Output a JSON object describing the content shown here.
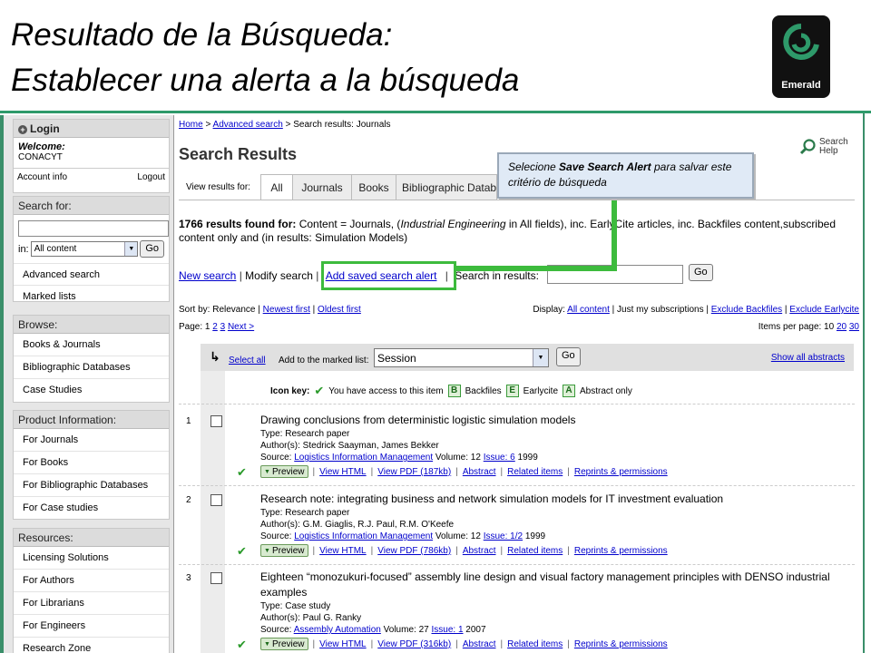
{
  "slide": {
    "title_line1": "Resultado de la Búsqueda:",
    "title_line2": "Establecer una alerta a la búsqueda",
    "logo_text": "Emerald"
  },
  "colors": {
    "accent_green": "#3dbb3d",
    "brand_green": "#2e9a6a",
    "link": "#0000cc"
  },
  "sidebar": {
    "login": {
      "title": "Login",
      "welcome": "Welcome:",
      "user": "CONACYT",
      "account_info": "Account info",
      "logout": "Logout"
    },
    "search": {
      "title": "Search for:",
      "in_label": "in:",
      "scope": "All content",
      "go": "Go",
      "items": [
        "Advanced search",
        "Marked lists"
      ]
    },
    "browse": {
      "title": "Browse:",
      "items": [
        "Books & Journals",
        "Bibliographic Databases",
        "Case Studies"
      ]
    },
    "product": {
      "title": "Product Information:",
      "items": [
        "For Journals",
        "For Books",
        "For Bibliographic Databases",
        "For Case studies"
      ]
    },
    "resources": {
      "title": "Resources:",
      "items": [
        "Licensing Solutions",
        "For Authors",
        "For Librarians",
        "For Engineers",
        "Research Zone"
      ]
    }
  },
  "breadcrumb": {
    "home": "Home",
    "sep": ">",
    "advanced": "Advanced search",
    "current": "Search results: Journals"
  },
  "header": {
    "title": "Search Results",
    "help_line1": "Search",
    "help_line2": "Help"
  },
  "tabs": {
    "label": "View results for:",
    "items": [
      "All",
      "Journals",
      "Books",
      "Bibliographic Datab"
    ]
  },
  "summary": {
    "count": "1766 results found for:",
    "prefix": "Content = Journals, (",
    "query": "Industrial Engineering",
    "suffix": " in All fields), inc. EarlyCite articles, inc. Backfiles content,subscribed content only and (in results: Simulation Models)"
  },
  "actions": {
    "new_search": "New search",
    "modify": "Modify search",
    "add_alert": "Add saved search alert",
    "search_in": "Search in results:",
    "go": "Go"
  },
  "sort": {
    "label": "Sort by: Relevance",
    "newest": "Newest first",
    "oldest": "Oldest first",
    "display_label": "Display:",
    "all_content": "All content",
    "subs_only": "Just my subscriptions",
    "excl_backfiles": "Exclude Backfiles",
    "excl_earlycite": "Exclude Earlycite"
  },
  "paging": {
    "label": "Page:",
    "p1": "1",
    "p2": "2",
    "p3": "3",
    "next": "Next >",
    "ipp_label": "Items per page: 10",
    "ipp_20": "20",
    "ipp_30": "30"
  },
  "marked": {
    "select_all": "Select all",
    "add_label": "Add to the marked list:",
    "list": "Session",
    "go": "Go",
    "show_abstracts": "Show all abstracts"
  },
  "icon_key": {
    "label": "Icon key:",
    "access": "You have access to this item",
    "b": "B",
    "backfiles": "Backfiles",
    "e": "E",
    "earlycite": "Earlycite",
    "a": "A",
    "abstract_only": "Abstract only"
  },
  "links": {
    "preview": "Preview",
    "html": "View HTML",
    "related": "Related items",
    "abstract": "Abstract",
    "reprints": "Reprints & permissions"
  },
  "results": [
    {
      "num": "1",
      "title": "Drawing conclusions from deterministic logistic simulation models",
      "type": "Type: Research paper",
      "authors": "Author(s): Stedrick Saayman, James Bekker",
      "source_label": "Source:",
      "journal": "Logistics Information Management",
      "volume": "Volume: 12",
      "issue": "Issue: 6",
      "year": "1999",
      "pdf": "View PDF (187kb)"
    },
    {
      "num": "2",
      "title": "Research note: integrating business and network simulation models for IT investment evaluation",
      "type": "Type: Research paper",
      "authors": "Author(s): G.M. Giaglis, R.J. Paul, R.M. O'Keefe",
      "source_label": "Source:",
      "journal": "Logistics Information Management",
      "volume": "Volume: 12",
      "issue": "Issue: 1/2",
      "year": "1999",
      "pdf": "View PDF (786kb)"
    },
    {
      "num": "3",
      "title": "Eighteen “monozukuri-focused” assembly line design and visual factory management principles with DENSO industrial examples",
      "type": "Type: Case study",
      "authors": "Author(s): Paul G. Ranky",
      "source_label": "Source:",
      "journal": "Assembly Automation",
      "volume": "Volume: 27",
      "issue": "Issue: 1",
      "year": "2007",
      "pdf": "View PDF (316kb)"
    }
  ],
  "callout": {
    "prefix": "Selecione ",
    "bold": "Save Search Alert",
    "suffix": " para salvar este critério de búsqueda"
  }
}
